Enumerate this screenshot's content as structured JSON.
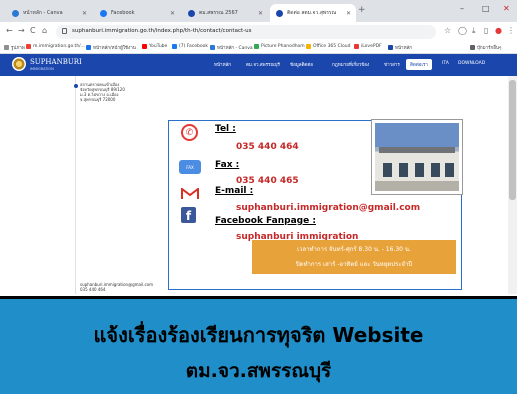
{
  "browser": {
    "tabs": [
      {
        "label": "หน้าหลัก - Canva",
        "color": "#2b79d6"
      },
      {
        "label": "Facebook",
        "color": "#1877f2"
      },
      {
        "label": "ตม.สพรรณ 2567",
        "color": "#1b47ad"
      },
      {
        "label": "ติดต่อ สตม.จว.สุพรรณ",
        "color": "#1b47ad"
      }
    ],
    "new_tab": "+",
    "url": "suphanburi.immigration.go.th/index.php/th-th/contact/contact-us",
    "controls": {
      "minimize": "–",
      "maximize": "□",
      "close": "✕"
    },
    "nav": {
      "back": "←",
      "forward": "→",
      "reload": "C",
      "home": "⌂"
    },
    "tools": {
      "star": "☆",
      "extensions": "◯",
      "download": "⤓",
      "sidebar": "▯",
      "profile": "●",
      "menu": "⋮"
    },
    "bookmarks": [
      {
        "label": "รูปภาพ",
        "color": "#8e8e8e"
      },
      {
        "label": "m.immigration.go.th/...",
        "color": "#ea4335"
      },
      {
        "label": "หน้าหลัก/หน้าผู้ใช้งาน",
        "color": "#1a73e8"
      },
      {
        "label": "YouTube",
        "color": "#ff0000"
      },
      {
        "label": "(7) Facebook",
        "color": "#1877f2"
      },
      {
        "label": "หน้าหลัก - Canva",
        "color": "#2b79d6"
      },
      {
        "label": "Picture Phanodhom",
        "color": "#34a853"
      },
      {
        "label": "Office 365 Cloud",
        "color": "#f4b400"
      },
      {
        "label": "iLovePDF",
        "color": "#e53935"
      },
      {
        "label": "หน้าหลัก",
        "color": "#1b47ad"
      },
      {
        "label": "บุ๊กมาร์กอื่นๆ",
        "color": "#5f6368"
      }
    ]
  },
  "site": {
    "logo_text": "SUPHANBURI",
    "logo_sub": "IMMIGRATION",
    "menu": [
      "หน้าหลัก",
      "ตม.จว.สพรรณบุรี",
      "ข้อมูลติดต่อ",
      "กฎหมายที่เกี่ยวข้อง",
      "ข่าวสาร",
      "ติดต่อเรา",
      "ITA",
      "DOWNLOAD"
    ],
    "active_menu": "ติดต่อเรา",
    "left_info": "สถานตรวจคนเข้าเมือง จังหวัดสุพรรณบุรี 89/120 ม.3 ต.ไผ่ขวาง อ.เมือง จ.สุพรรณบุรี 72000",
    "bottom_email": "suphanburi.immigration@gmail.com",
    "bottom_phone": "035 440 464"
  },
  "contact": {
    "tel_label": "Tel :",
    "tel_value": "035 440 464",
    "fax_label": "Fax :",
    "fax_value": "035 440 465",
    "email_label": "E-mail :",
    "email_value": "suphanburi.immigration@gmail.com",
    "fb_label": "Facebook Fanpage :",
    "fb_value": "suphanburi immigration",
    "fax_icon_text": "FAX",
    "phone_icon": "✆",
    "fb_icon": "f",
    "hours_line1": "เวลาทำการ จันทร์-ศุกร์ 8.30 น. - 16.30 น.",
    "hours_line2": "ปิดทำการ เสาร์ -อาทิตย์ และ วันหยุดประจำปี"
  },
  "banner": {
    "line1": "แจ้งเรื่องร้องเรียนการทุจริต Website",
    "line2": "ตม.จว.สพรรณบุรี",
    "background": "#1f8ec9"
  }
}
